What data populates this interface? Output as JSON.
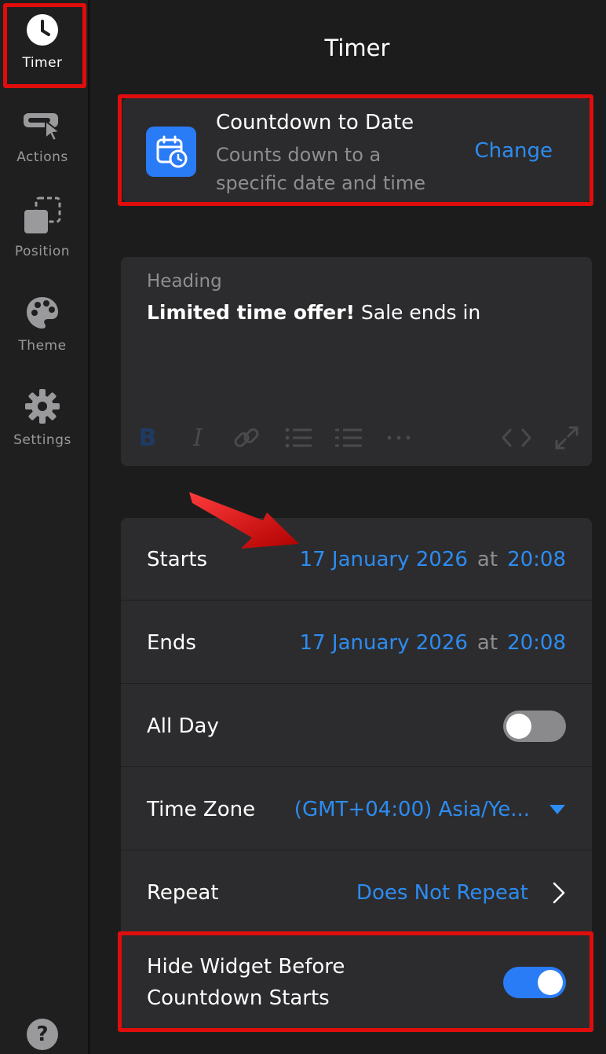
{
  "sidebar": {
    "items": [
      {
        "label": "Timer",
        "icon": "clock-icon",
        "active": true
      },
      {
        "label": "Actions",
        "icon": "cursor-click-icon"
      },
      {
        "label": "Position",
        "icon": "position-icon"
      },
      {
        "label": "Theme",
        "icon": "palette-icon"
      },
      {
        "label": "Settings",
        "icon": "gear-icon"
      }
    ],
    "help": "?"
  },
  "main": {
    "title": "Timer",
    "timer_type": {
      "title": "Countdown to Date",
      "description": "Counts down to a specific date and time",
      "change_label": "Change",
      "icon": "calendar-clock-icon"
    },
    "heading": {
      "label": "Heading",
      "text_bold": "Limited time offer!",
      "text_regular": " Sale ends in"
    },
    "rows": {
      "starts": {
        "label": "Starts",
        "date": "17 January 2026",
        "at": "at",
        "time": "20:08"
      },
      "ends": {
        "label": "Ends",
        "date": "17 January 2026",
        "at": "at",
        "time": "20:08"
      },
      "all_day": {
        "label": "All Day",
        "on": false
      },
      "time_zone": {
        "label": "Time Zone",
        "value": "(GMT+04:00) Asia/Ye..."
      },
      "repeat": {
        "label": "Repeat",
        "value": "Does Not Repeat"
      },
      "hide_widget": {
        "label_line1": "Hide Widget Before",
        "label_line2": "Countdown Starts",
        "on": true
      }
    }
  },
  "colors": {
    "accent": "#2d8cf0",
    "highlight": "#e00d0d",
    "toggle_on": "#2a7bf6"
  }
}
